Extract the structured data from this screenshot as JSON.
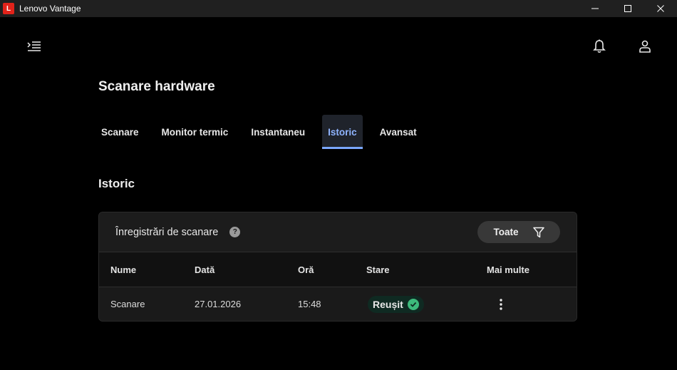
{
  "window": {
    "title": "Lenovo Vantage",
    "logo_letter": "L"
  },
  "page": {
    "title": "Scanare hardware",
    "tabs": [
      {
        "label": "Scanare"
      },
      {
        "label": "Monitor termic"
      },
      {
        "label": "Instantaneu"
      },
      {
        "label": "Istoric",
        "active": true
      },
      {
        "label": "Avansat"
      }
    ],
    "section_title": "Istoric"
  },
  "records": {
    "title": "Înregistrări de scanare",
    "help_icon": "question-circle-icon",
    "filter_label": "Toate",
    "filter_icon": "filter-icon",
    "columns": [
      "Nume",
      "Dată",
      "Oră",
      "Stare",
      "Mai multe"
    ],
    "rows": [
      {
        "name": "Scanare",
        "date": "27.01.2026",
        "time": "15:48",
        "status": "Reușit"
      }
    ]
  },
  "colors": {
    "accent": "#7aa7ff",
    "success": "#3dba7c",
    "brand": "#e2231a"
  }
}
